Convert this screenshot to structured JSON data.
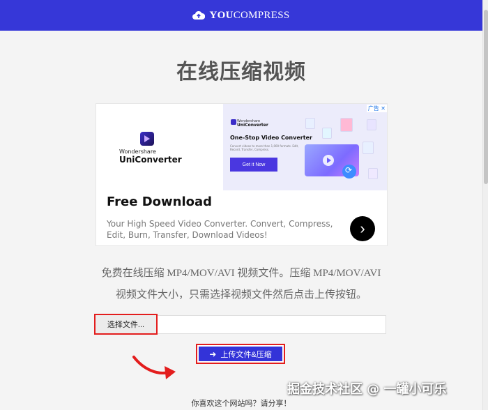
{
  "header": {
    "brand_bold": "YOU",
    "brand_rest": "COMPRESS",
    "bg_color": "#3637d8"
  },
  "main": {
    "title": "在线压缩视频",
    "description_line1": "免费在线压缩 MP4/MOV/AVI 视频文件。压缩 MP4/MOV/AVI",
    "description_line2": "视频文件大小，只需选择视频文件然后点击上传按钮。"
  },
  "ad": {
    "label": "广告",
    "logo_brand_small": "Wondershare",
    "logo_brand_big": "UniConverter",
    "promo_brand_small": "Wondershare",
    "promo_brand_big": "UniConverter",
    "promo_title": "One-Stop Video Converter",
    "promo_desc": "Convert videos to more than 1,000 formats. Edit, Record, Transfer, Compress.",
    "cta": "Get it Now",
    "heading": "Free Download",
    "text": "Your High Speed Video Converter. Convert, Compress, Edit, Burn, Transfer, Download Videos!"
  },
  "form": {
    "choose_label": "选择文件...",
    "upload_label": "上传文件&压缩",
    "highlight_color": "#e31d1d",
    "button_color": "#3333d8"
  },
  "footer": {
    "share_text": "你喜欢这个网站吗？请分享！",
    "watermark": "掘金技术社区 @ 一罐小可乐"
  }
}
